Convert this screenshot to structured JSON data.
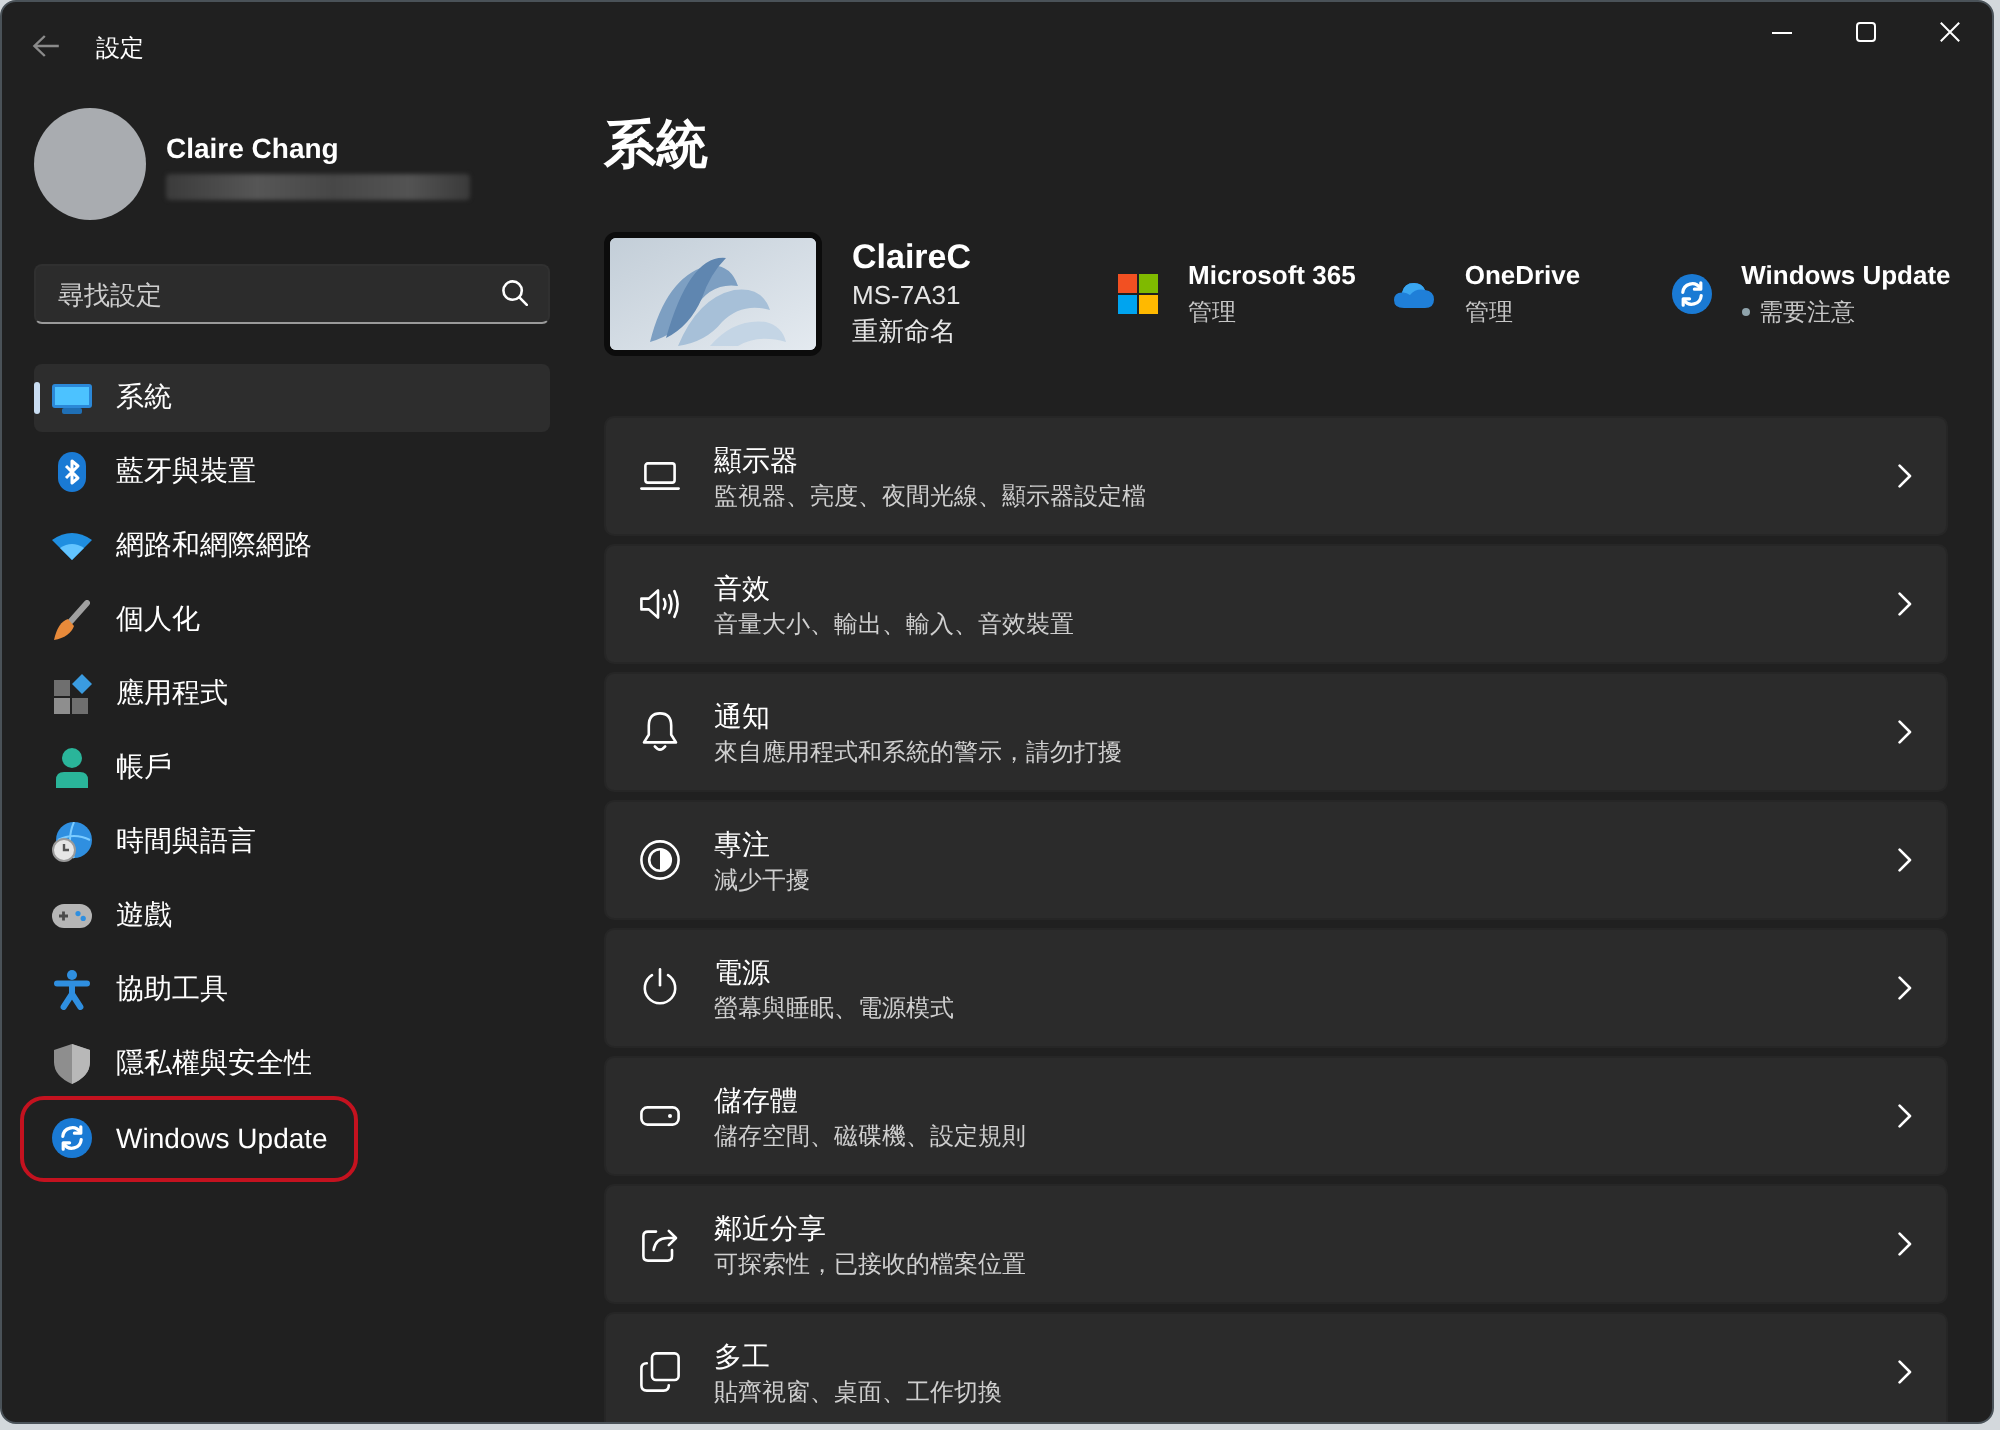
{
  "window": {
    "title": "設定"
  },
  "account": {
    "name": "Claire Chang"
  },
  "search": {
    "placeholder": "尋找設定"
  },
  "sidebar": {
    "items": [
      {
        "label": "系統",
        "selected": true,
        "highlighted": false
      },
      {
        "label": "藍牙與裝置",
        "selected": false,
        "highlighted": false
      },
      {
        "label": "網路和網際網路",
        "selected": false,
        "highlighted": false
      },
      {
        "label": "個人化",
        "selected": false,
        "highlighted": false
      },
      {
        "label": "應用程式",
        "selected": false,
        "highlighted": false
      },
      {
        "label": "帳戶",
        "selected": false,
        "highlighted": false
      },
      {
        "label": "時間與語言",
        "selected": false,
        "highlighted": false
      },
      {
        "label": "遊戲",
        "selected": false,
        "highlighted": false
      },
      {
        "label": "協助工具",
        "selected": false,
        "highlighted": false
      },
      {
        "label": "隱私權與安全性",
        "selected": false,
        "highlighted": false
      },
      {
        "label": "Windows Update",
        "selected": false,
        "highlighted": true
      }
    ]
  },
  "page": {
    "title": "系統"
  },
  "device": {
    "name": "ClaireC",
    "model": "MS-7A31",
    "rename": "重新命名"
  },
  "tiles": [
    {
      "title": "Microsoft 365",
      "subtitle": "管理",
      "attention": false
    },
    {
      "title": "OneDrive",
      "subtitle": "管理",
      "attention": false
    },
    {
      "title": "Windows Update",
      "subtitle": "需要注意",
      "attention": true
    }
  ],
  "settings": [
    {
      "title": "顯示器",
      "description": "監視器、亮度、夜間光線、顯示器設定檔"
    },
    {
      "title": "音效",
      "description": "音量大小、輸出、輸入、音效裝置"
    },
    {
      "title": "通知",
      "description": "來自應用程式和系統的警示，請勿打擾"
    },
    {
      "title": "專注",
      "description": "減少干擾"
    },
    {
      "title": "電源",
      "description": "螢幕與睡眠、電源模式"
    },
    {
      "title": "儲存體",
      "description": "儲存空間、磁碟機、設定規則"
    },
    {
      "title": "鄰近分享",
      "description": "可探索性，已接收的檔案位置"
    },
    {
      "title": "多工",
      "description": "貼齊視窗、桌面、工作切換"
    }
  ]
}
